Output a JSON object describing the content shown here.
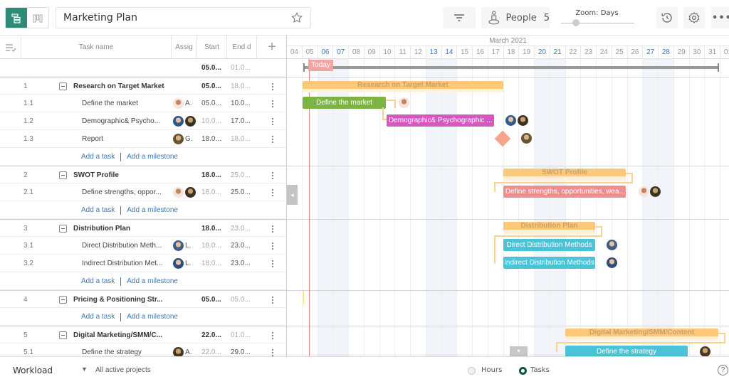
{
  "toolbar": {
    "title": "Marketing Plan",
    "people_label": "People",
    "people_count": "5",
    "zoom_label": "Zoom: Days",
    "zoom_level": "Days"
  },
  "grid": {
    "columns": {
      "task_name": "Task name",
      "assignee": "Assig",
      "start": "Start",
      "end": "End d"
    },
    "summary": {
      "start": "05.0...",
      "end": "01.0..."
    },
    "add_task": "Add a task",
    "add_milestone": "Add a milestone",
    "rows": [
      {
        "num": "1",
        "name": "Research on Target Market",
        "start": "05.0...",
        "end": "18.0...",
        "type": "project"
      },
      {
        "num": "1.1",
        "name": "Define the market",
        "assignee": "A.",
        "start": "05.0...",
        "end": "10.0...",
        "type": "task"
      },
      {
        "num": "1.2",
        "name": "Demographic& Psycho...",
        "assignee": "",
        "start": "10.0...",
        "end": "17.0...",
        "type": "task"
      },
      {
        "num": "1.3",
        "name": "Report",
        "assignee": "G.",
        "start": "18.0...",
        "end": "18.0...",
        "type": "milestone"
      },
      {
        "num": "2",
        "name": "SWOT Profile",
        "start": "18.0...",
        "end": "25.0...",
        "type": "project"
      },
      {
        "num": "2.1",
        "name": "Define strengths, oppor...",
        "assignee": "",
        "start": "18.0...",
        "end": "25.0...",
        "type": "task"
      },
      {
        "num": "3",
        "name": "Distribution Plan",
        "start": "18.0...",
        "end": "23.0...",
        "type": "project"
      },
      {
        "num": "3.1",
        "name": "Direct Distribution Meth...",
        "assignee": "L.",
        "start": "18.0...",
        "end": "23.0...",
        "type": "task"
      },
      {
        "num": "3.2",
        "name": "Indirect Distribution Met...",
        "assignee": "L.",
        "start": "18.0...",
        "end": "23.0...",
        "type": "task"
      },
      {
        "num": "4",
        "name": "Pricing & Positioning Str...",
        "start": "05.0...",
        "end": "05.0...",
        "type": "project"
      },
      {
        "num": "5",
        "name": "Digital Marketing/SMM/C...",
        "start": "22.0...",
        "end": "01.0...",
        "type": "project"
      },
      {
        "num": "5.1",
        "name": "Define the strategy",
        "assignee": "A.",
        "start": "22.0...",
        "end": "29.0...",
        "type": "task"
      }
    ]
  },
  "timeline": {
    "month": "March 2021",
    "days": [
      "04",
      "05",
      "06",
      "07",
      "08",
      "09",
      "10",
      "11",
      "12",
      "13",
      "14",
      "15",
      "16",
      "17",
      "18",
      "19",
      "20",
      "21",
      "22",
      "23",
      "24",
      "25",
      "26",
      "27",
      "28",
      "29",
      "30",
      "31",
      "01"
    ],
    "weekend_days": [
      "06",
      "07",
      "13",
      "14",
      "20",
      "21",
      "27",
      "28"
    ],
    "today_label": "Today",
    "bars": [
      {
        "label": "Research on Target Market",
        "kind": "project",
        "color": "#fcc97b"
      },
      {
        "label": "Define the market",
        "kind": "task",
        "color": "#7cb342"
      },
      {
        "label": "Demographic& Psychographic ...",
        "kind": "task",
        "color": "#d557c0"
      },
      {
        "label": "SWOT Profile",
        "kind": "project",
        "color": "#fcc97b"
      },
      {
        "label": "Define strengths, opportunities, wea...",
        "kind": "task",
        "color": "#ef8e8e"
      },
      {
        "label": "Distribution Plan",
        "kind": "project",
        "color": "#fcc97b"
      },
      {
        "label": "Direct Distribution Methods",
        "kind": "task",
        "color": "#4bc3d6"
      },
      {
        "label": "Indirect Distribution Methods",
        "kind": "task",
        "color": "#4bc3d6"
      },
      {
        "label": "Digital Marketing/SMM/Content",
        "kind": "project",
        "color": "#fcc97b"
      },
      {
        "label": "Define the strategy",
        "kind": "task",
        "color": "#4bc3d6"
      }
    ]
  },
  "footer": {
    "workload_label": "Workload",
    "projects_filter": "All active projects",
    "hours_label": "Hours",
    "tasks_label": "Tasks",
    "selected_mode": "Tasks"
  },
  "colors": {
    "accent": "#2e8b77",
    "link": "#3a79b7",
    "today": "#f4a3a3",
    "weekend": "#3b7ac0"
  }
}
